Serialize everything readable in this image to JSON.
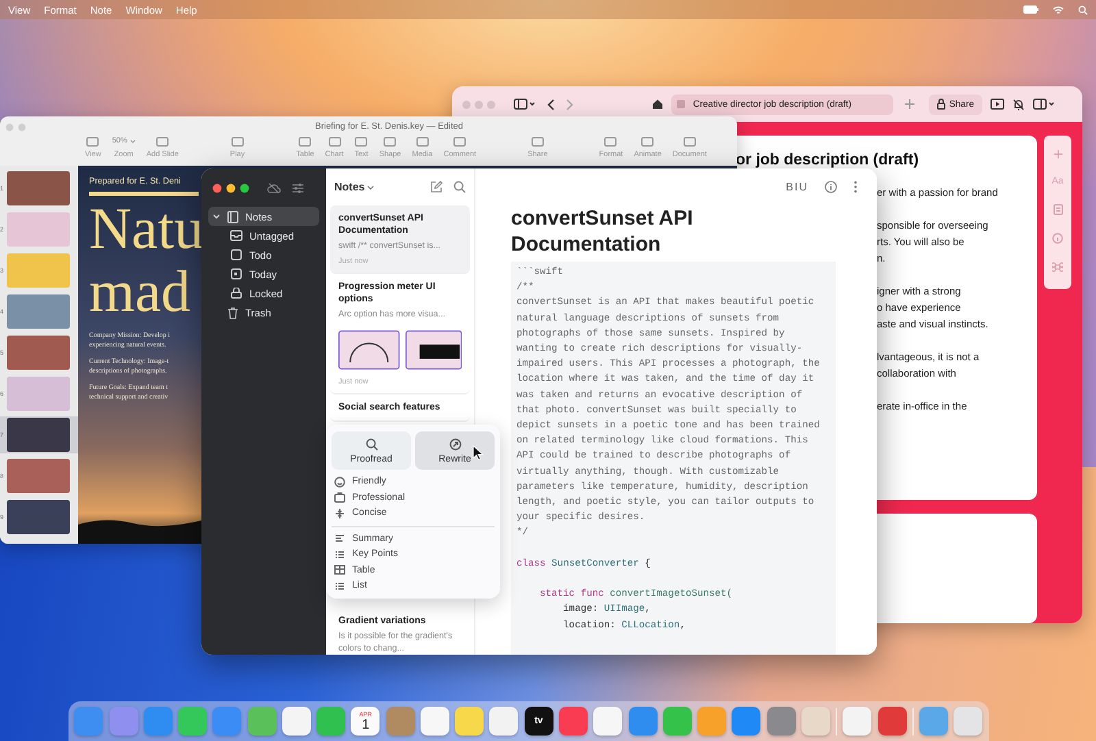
{
  "menu_bar": {
    "items": [
      "View",
      "Format",
      "Note",
      "Window",
      "Help"
    ]
  },
  "browser": {
    "tab_title": "Creative director job description (draft)",
    "share": "Share",
    "heading": "or job description (draft)",
    "side_label": "Aa",
    "paragraphs": [
      [
        "er with a passion for brand"
      ],
      [
        "sponsible for overseeing",
        "rts. You will also be",
        "n."
      ],
      [
        "igner with a strong",
        "o have experience",
        "aste and visual instincts."
      ],
      [
        "lvantageous, it is not a",
        "collaboration with"
      ],
      [
        "erate in-office in the"
      ]
    ]
  },
  "keynote": {
    "title": "Briefing for E. St. Denis.key — Edited",
    "toolbar_groups": [
      [
        {
          "label": "View"
        },
        {
          "label": "Zoom",
          "value": "50%"
        },
        {
          "label": "Add Slide"
        }
      ],
      [
        {
          "label": "Play"
        }
      ],
      [
        {
          "label": "Table"
        },
        {
          "label": "Chart"
        },
        {
          "label": "Text"
        },
        {
          "label": "Shape"
        },
        {
          "label": "Media"
        },
        {
          "label": "Comment"
        }
      ],
      [
        {
          "label": "Share"
        }
      ],
      [
        {
          "label": "Format"
        },
        {
          "label": "Animate"
        },
        {
          "label": "Document"
        }
      ]
    ],
    "slides": [
      {
        "number": "1",
        "selected": false,
        "color": "#8a5548"
      },
      {
        "number": "2",
        "selected": false,
        "color": "#e6c6d6"
      },
      {
        "number": "3",
        "selected": false,
        "color": "#f0c44a"
      },
      {
        "number": "4",
        "selected": false,
        "color": "#7a90a6"
      },
      {
        "number": "5",
        "selected": false,
        "color": "#a05a50"
      },
      {
        "number": "6",
        "selected": false,
        "color": "#d6bed6"
      },
      {
        "number": "7",
        "selected": true,
        "color": "#3a3848"
      },
      {
        "number": "8",
        "selected": false,
        "color": "#a86058"
      },
      {
        "number": "9",
        "selected": false,
        "color": "#3a4058"
      }
    ],
    "slide": {
      "subtitle": "Prepared for E. St. Deni",
      "headline": [
        "Natu",
        "mad"
      ],
      "bullets": [
        [
          "Company Mission: Develop i",
          "experiencing natural events."
        ],
        [
          "Current Technology: Image-t",
          "descriptions of photographs."
        ],
        [
          "Future Goals: Expand team t",
          "technical support and creativ"
        ]
      ]
    }
  },
  "notes": {
    "sidebar": {
      "items": [
        {
          "label": "Notes",
          "selected": true,
          "expanded": true,
          "children": [
            {
              "label": "Untagged",
              "selected": false
            },
            {
              "label": "Todo",
              "selected": false
            },
            {
              "label": "Today",
              "selected": false
            },
            {
              "label": "Locked",
              "selected": false
            }
          ]
        },
        {
          "label": "Trash",
          "selected": false
        }
      ]
    },
    "list": {
      "title": "Notes",
      "notes": [
        {
          "title": "convertSunset API Documentation",
          "preview": "swift /** convertSunset is...",
          "time": "Just now",
          "selected": true,
          "has_images": false
        },
        {
          "title": "Progression meter UI options",
          "preview": "Arc option has more visua...",
          "time": "Just now",
          "selected": false,
          "has_images": true
        },
        {
          "title": "Social search features",
          "selected": false,
          "has_images": false
        },
        {
          "title": "Gradient variations",
          "preview": "Is it possible for the gradient's colors to chang...",
          "selected": false,
          "has_images": false
        }
      ]
    },
    "popup": {
      "actions": [
        {
          "label": "Proofread",
          "selected": false
        },
        {
          "label": "Rewrite",
          "selected": true
        }
      ],
      "tones": [
        "Friendly",
        "Professional",
        "Concise"
      ],
      "formats": [
        "Summary",
        "Key Points",
        "Table",
        "List"
      ]
    },
    "editor": {
      "format_label": "BIU",
      "title": "convertSunset API Documentation",
      "code": [
        {
          "kind": "code",
          "tokens": [
            {
              "t": "```swift",
              "kind": "comment"
            }
          ]
        },
        {
          "kind": "code",
          "tokens": [
            {
              "t": "/**",
              "kind": "comment"
            }
          ]
        },
        {
          "kind": "code",
          "tokens": [
            {
              "t": "convertSunset is an API that makes beautiful poetic",
              "kind": "comment"
            }
          ]
        },
        {
          "kind": "code",
          "tokens": [
            {
              "t": "natural language descriptions of sunsets from",
              "kind": "comment"
            }
          ]
        },
        {
          "kind": "code",
          "tokens": [
            {
              "t": "photographs of those same sunsets. Inspired by",
              "kind": "comment"
            }
          ]
        },
        {
          "kind": "code",
          "tokens": [
            {
              "t": "wanting to create rich descriptions for visually-",
              "kind": "comment"
            }
          ]
        },
        {
          "kind": "code",
          "tokens": [
            {
              "t": "impaired users. This API processes a photograph, the",
              "kind": "comment"
            }
          ]
        },
        {
          "kind": "code",
          "tokens": [
            {
              "t": "location where it was taken, and the time of day it",
              "kind": "comment"
            }
          ]
        },
        {
          "kind": "code",
          "tokens": [
            {
              "t": "was taken and returns an evocative description of",
              "kind": "comment"
            }
          ]
        },
        {
          "kind": "code",
          "tokens": [
            {
              "t": "that photo. convertSunset was built specially to",
              "kind": "comment"
            }
          ]
        },
        {
          "kind": "code",
          "tokens": [
            {
              "t": "depict sunsets in a poetic tone and has been trained",
              "kind": "comment"
            }
          ]
        },
        {
          "kind": "code",
          "tokens": [
            {
              "t": "on related terminology like cloud formations. This",
              "kind": "comment"
            }
          ]
        },
        {
          "kind": "code",
          "tokens": [
            {
              "t": "API could be trained to describe photographs of",
              "kind": "comment"
            }
          ]
        },
        {
          "kind": "code",
          "tokens": [
            {
              "t": "virtually anything, though. With customizable",
              "kind": "comment"
            }
          ]
        },
        {
          "kind": "code",
          "tokens": [
            {
              "t": "parameters like temperature, humidity, description",
              "kind": "comment"
            }
          ]
        },
        {
          "kind": "code",
          "tokens": [
            {
              "t": "length, and poetic style, you can tailor outputs to",
              "kind": "comment"
            }
          ]
        },
        {
          "kind": "code",
          "tokens": [
            {
              "t": "your specific desires.",
              "kind": "comment"
            }
          ]
        },
        {
          "kind": "code",
          "tokens": [
            {
              "t": "*/",
              "kind": "comment"
            }
          ]
        },
        {
          "kind": "blank"
        },
        {
          "kind": "code",
          "tokens": [
            {
              "t": "class",
              "kind": "keyword"
            },
            {
              "t": " SunsetConverter",
              "kind": "type"
            },
            {
              "t": " {",
              "kind": "plain"
            }
          ]
        },
        {
          "kind": "blank"
        },
        {
          "kind": "code",
          "tokens": [
            {
              "t": "    static func",
              "kind": "keyword"
            },
            {
              "t": " convertImagetoSunset(",
              "kind": "func"
            }
          ]
        },
        {
          "kind": "code",
          "tokens": [
            {
              "t": "        image: ",
              "kind": "plain"
            },
            {
              "t": "UIImage",
              "kind": "type"
            },
            {
              "t": ",",
              "kind": "plain"
            }
          ]
        },
        {
          "kind": "code",
          "tokens": [
            {
              "t": "        location: ",
              "kind": "plain"
            },
            {
              "t": "CLLocation",
              "kind": "type"
            },
            {
              "t": ",",
              "kind": "plain"
            }
          ]
        }
      ]
    }
  },
  "dock": {
    "items": [
      {
        "kind": "app",
        "color": "#3d8ef0"
      },
      {
        "kind": "app",
        "color": "#8f8ff0"
      },
      {
        "kind": "app",
        "color": "#2f8cf0"
      },
      {
        "kind": "app",
        "color": "#34c759"
      },
      {
        "kind": "app",
        "color": "#3b8df5"
      },
      {
        "kind": "app",
        "color": "#5ac05a"
      },
      {
        "kind": "app",
        "color": "#f4f4f4"
      },
      {
        "kind": "app",
        "color": "#30c050"
      },
      {
        "kind": "app",
        "color": "#fafafa",
        "month": "APR",
        "day": "1"
      },
      {
        "kind": "app",
        "color": "#b08a60"
      },
      {
        "kind": "app",
        "color": "#f7f7f7"
      },
      {
        "kind": "app",
        "color": "#f7d84a"
      },
      {
        "kind": "app",
        "color": "#f2f2f2"
      },
      {
        "kind": "app",
        "color": "#111111",
        "label": "tv"
      },
      {
        "kind": "app",
        "color": "#fa3c52"
      },
      {
        "kind": "app",
        "color": "#f6f6f6"
      },
      {
        "kind": "app",
        "color": "#2f8df0"
      },
      {
        "kind": "app",
        "color": "#35c24a"
      },
      {
        "kind": "app",
        "color": "#f7a12a"
      },
      {
        "kind": "app",
        "color": "#1f8af5"
      },
      {
        "kind": "app",
        "color": "#8a8a8e"
      },
      {
        "kind": "app",
        "color": "#e8d8c8"
      },
      {
        "kind": "separator"
      },
      {
        "kind": "app",
        "color": "#f3f3f3"
      },
      {
        "kind": "app",
        "color": "#e03a3a"
      },
      {
        "kind": "separator"
      },
      {
        "kind": "app",
        "color": "#5aa8e8"
      },
      {
        "kind": "app",
        "color": "#e4e4e6"
      }
    ]
  }
}
